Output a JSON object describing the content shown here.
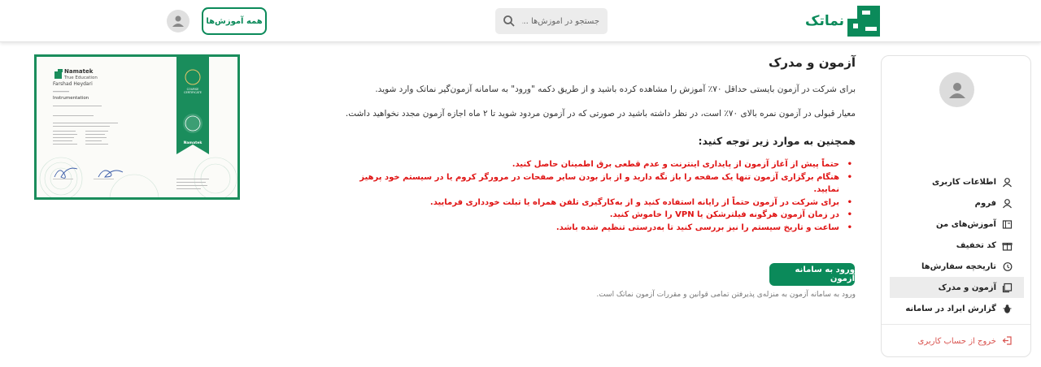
{
  "header": {
    "brand_name": "نماتک",
    "search_placeholder": "جستجو در آموزش‌ها ...",
    "all_courses_label": "همه آموزش‌ها"
  },
  "sidebar": {
    "items": [
      {
        "label": "اطلاعات کاربری",
        "icon": "user-icon"
      },
      {
        "label": "فروم",
        "icon": "user-icon"
      },
      {
        "label": "آموزش‌های من",
        "icon": "book-icon"
      },
      {
        "label": "کد تخفیف",
        "icon": "gift-icon"
      },
      {
        "label": "تاریخچه سفارش‌ها",
        "icon": "history-icon"
      },
      {
        "label": "آزمون و مدرک",
        "icon": "certificate-icon",
        "active": true
      },
      {
        "label": "گزارش ایراد در سامانه",
        "icon": "bug-icon"
      }
    ],
    "logout_label": "خروج از حساب کاربری"
  },
  "main": {
    "title": "آزمون و مدرک",
    "para1": "برای شرکت در آزمون بایستی حداقل ۷۰٪ آموزش را مشاهده کرده باشید و از طریق دکمه \"ورود\" به سامانه آزمون‌گیر نماتک وارد شوید.",
    "para2": "معیار قبولی در آزمون نمره بالای ۷۰٪ است، در نظر داشته باشید در صورتی که در آزمون مردود شوید تا ۲ ماه اجازه آزمون مجدد نخواهید داشت.",
    "subheading": "همچنین به موارد زیر توجه کنید:",
    "rules": [
      "حتماً پیش از آغاز آزمون از پایداری اینترنت و عدم قطعی برق اطمینان حاصل کنید.",
      "هنگام برگزاری آزمون تنها یک صفحه را باز نگه دارید و از باز بودن سایر صفحات در مرورگر کروم یا در سیستم خود پرهیز نمایید.",
      "برای شرکت در آزمون حتماً از رایانه استفاده کنید و از به‌کارگیری تلفن همراه یا تبلت خودداری فرمایید.",
      "در زمان آزمون هرگونه فیلترشکن یا VPN را خاموش کنید.",
      "ساعت و تاریخ سیستم را نیز بررسی کنید تا به‌درستی تنظیم شده باشد."
    ],
    "enter_button": "ورود به سامانه آزمون",
    "note": "ورود به سامانه آزمون به منزله‌ی پذیرفتن تمامی قوانین و مقررات آزمون نماتک است."
  },
  "certificate": {
    "brand": "Namatek",
    "tagline": "True Education",
    "ribbon_brand": "Namatek",
    "course_label": "COURSE CERTIFICATE",
    "recipient": "Farshad Heydari",
    "course": "Instrumentation"
  },
  "colors": {
    "brand_green": "#0b8a5a",
    "danger_red": "#e01414",
    "logout_red": "#d9534f"
  }
}
